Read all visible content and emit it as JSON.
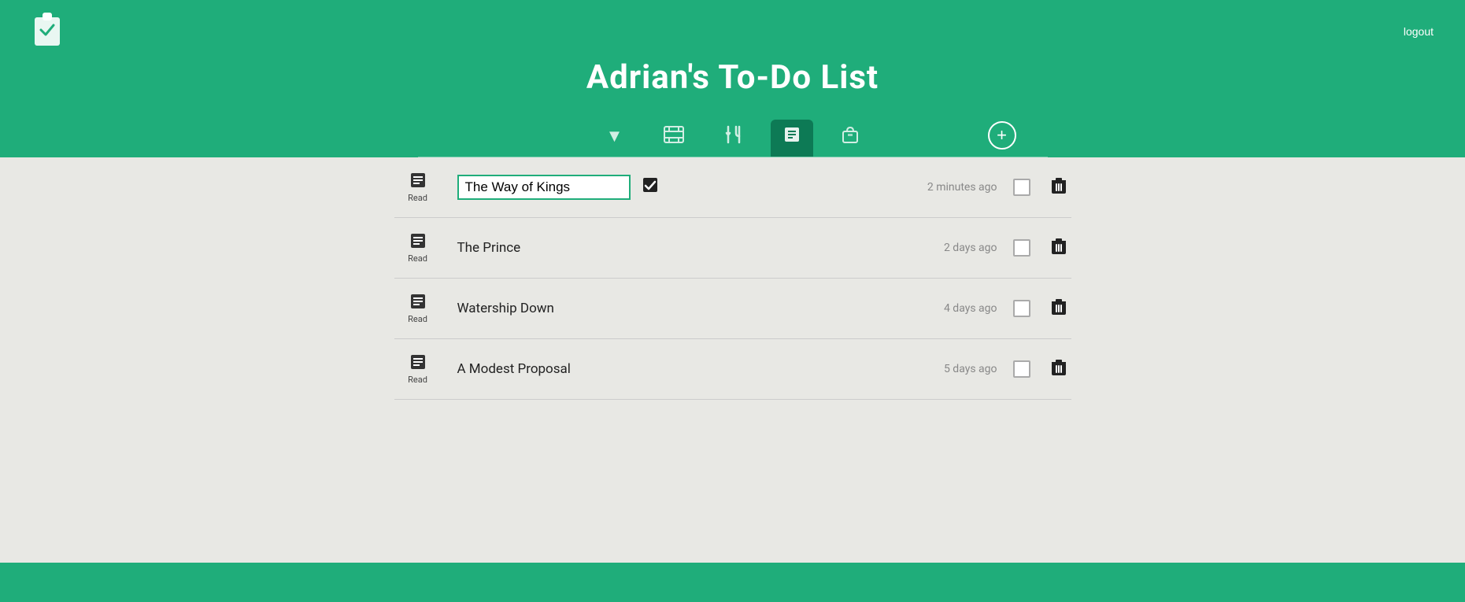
{
  "header": {
    "title": "Adrian's To-Do List",
    "logout_label": "logout"
  },
  "tabs": [
    {
      "id": "all",
      "icon": "▼",
      "label": "",
      "active": false
    },
    {
      "id": "movies",
      "icon": "⬛",
      "label": "",
      "active": false
    },
    {
      "id": "food",
      "icon": "🍴",
      "label": "",
      "active": false
    },
    {
      "id": "read",
      "icon": "📋",
      "label": "",
      "active": true
    },
    {
      "id": "shop",
      "icon": "🛍",
      "label": "",
      "active": false
    }
  ],
  "add_button_label": "+",
  "tasks": [
    {
      "id": 1,
      "category_icon": "📖",
      "category_label": "Read",
      "name": "The Way of Kings",
      "name_input_value": "The Way of Kings",
      "editing": true,
      "time": "2 minutes ago"
    },
    {
      "id": 2,
      "category_icon": "📖",
      "category_label": "Read",
      "name": "The Prince",
      "editing": false,
      "time": "2 days ago"
    },
    {
      "id": 3,
      "category_icon": "📖",
      "category_label": "Read",
      "name": "Watership Down",
      "editing": false,
      "time": "4 days ago"
    },
    {
      "id": 4,
      "category_icon": "📖",
      "category_label": "Read",
      "name": "A Modest Proposal",
      "editing": false,
      "time": "5 days ago"
    }
  ]
}
